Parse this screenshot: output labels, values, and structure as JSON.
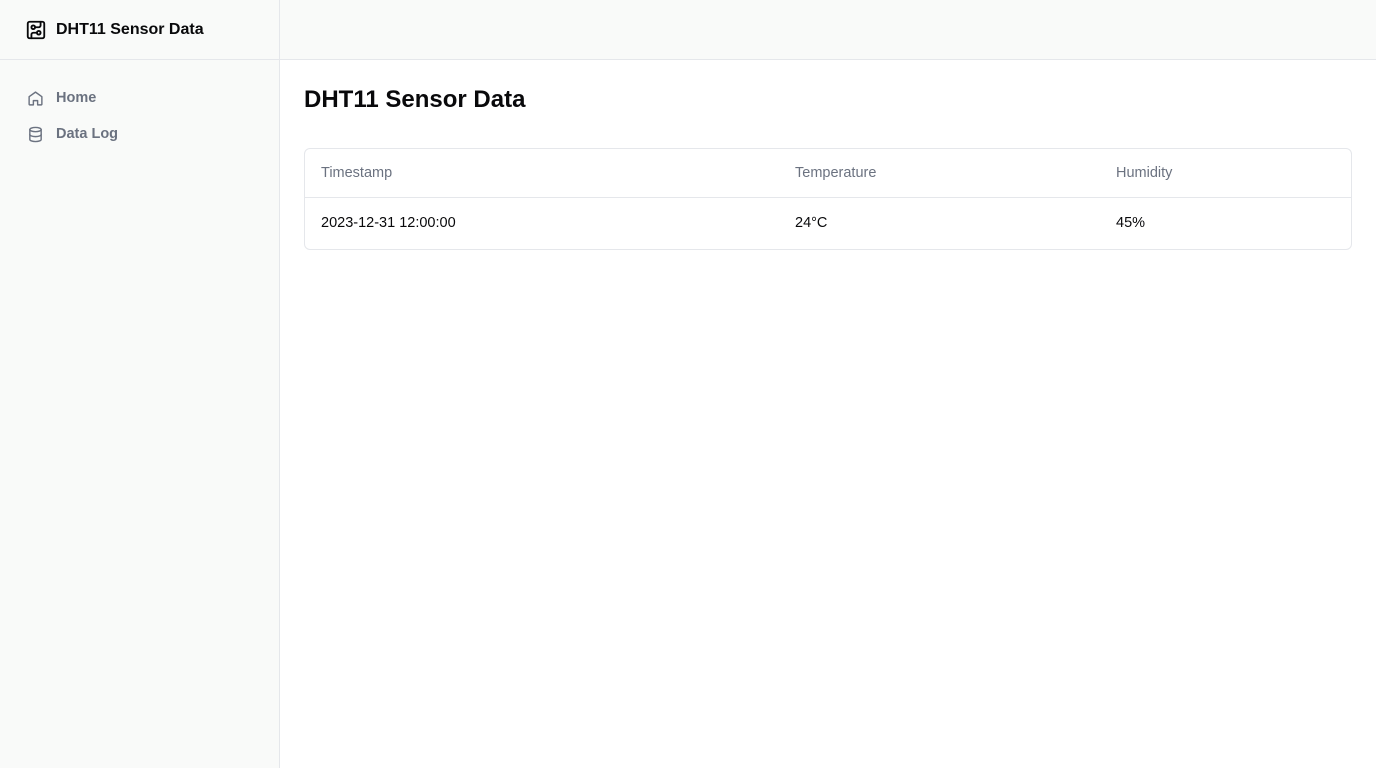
{
  "app": {
    "title": "DHT11 Sensor Data"
  },
  "sidebar": {
    "items": [
      {
        "label": "Home",
        "icon": "home-icon"
      },
      {
        "label": "Data Log",
        "icon": "database-icon"
      }
    ]
  },
  "main": {
    "title": "DHT11 Sensor Data",
    "table": {
      "headers": [
        "Timestamp",
        "Temperature",
        "Humidity"
      ],
      "rows": [
        [
          "2023-12-31 12:00:00",
          "24°C",
          "45%"
        ]
      ]
    }
  },
  "colors": {
    "sidebar_bg": "#f9faf9",
    "border": "#e5e7eb",
    "muted_text": "#6b7280",
    "text": "#09090b"
  }
}
